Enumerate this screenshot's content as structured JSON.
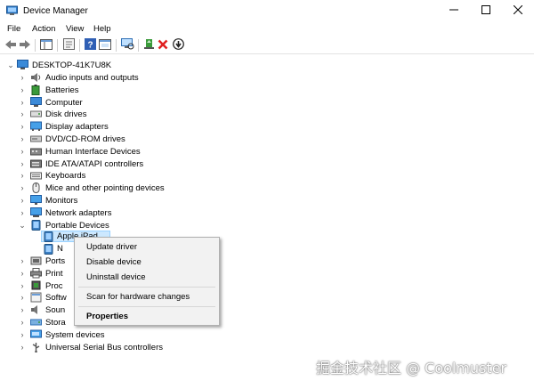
{
  "window": {
    "title": "Device Manager",
    "minimize_icon": "minimize-icon",
    "maximize_icon": "maximize-icon",
    "close_icon": "close-icon"
  },
  "menu": [
    "File",
    "Action",
    "View",
    "Help"
  ],
  "toolbar": {
    "icons": [
      "back-arrow-icon",
      "forward-arrow-icon",
      "show-hide-console-tree-icon",
      "properties-icon",
      "help-icon",
      "export-icon",
      "scan-hardware-icon",
      "update-driver-icon",
      "uninstall-icon",
      "disable-icon"
    ]
  },
  "tree": {
    "root": "DESKTOP-41K7U8K",
    "categories": [
      {
        "label": "Audio inputs and outputs",
        "icon": "speaker-icon"
      },
      {
        "label": "Batteries",
        "icon": "battery-icon"
      },
      {
        "label": "Computer",
        "icon": "computer-icon"
      },
      {
        "label": "Disk drives",
        "icon": "disk-drive-icon"
      },
      {
        "label": "Display adapters",
        "icon": "display-adapter-icon"
      },
      {
        "label": "DVD/CD-ROM drives",
        "icon": "dvd-drive-icon"
      },
      {
        "label": "Human Interface Devices",
        "icon": "hid-icon"
      },
      {
        "label": "IDE ATA/ATAPI controllers",
        "icon": "ide-controller-icon"
      },
      {
        "label": "Keyboards",
        "icon": "keyboard-icon"
      },
      {
        "label": "Mice and other pointing devices",
        "icon": "mouse-icon"
      },
      {
        "label": "Monitors",
        "icon": "monitor-icon"
      },
      {
        "label": "Network adapters",
        "icon": "network-adapter-icon"
      },
      {
        "label": "Portable Devices",
        "icon": "portable-device-icon"
      }
    ],
    "portable_children": [
      "Apple iPad",
      "N"
    ],
    "partial_categories": [
      "Ports",
      "Print",
      "Proc",
      "Softw",
      "Soun",
      "Stora"
    ],
    "bottom_categories": [
      {
        "label": "System devices",
        "icon": "system-device-icon"
      },
      {
        "label": "Universal Serial Bus controllers",
        "icon": "usb-icon"
      }
    ]
  },
  "context_menu": {
    "items": [
      "Update driver",
      "Disable device",
      "Uninstall device",
      "Scan for hardware changes",
      "Properties"
    ]
  },
  "watermark": "掘金技术社区 @ Coolmuster",
  "colors": {
    "selection_bg": "#cce8ff",
    "selection_border": "#99d1ff",
    "menu_bg": "#f2f2f2",
    "close_red": "#e81123"
  }
}
